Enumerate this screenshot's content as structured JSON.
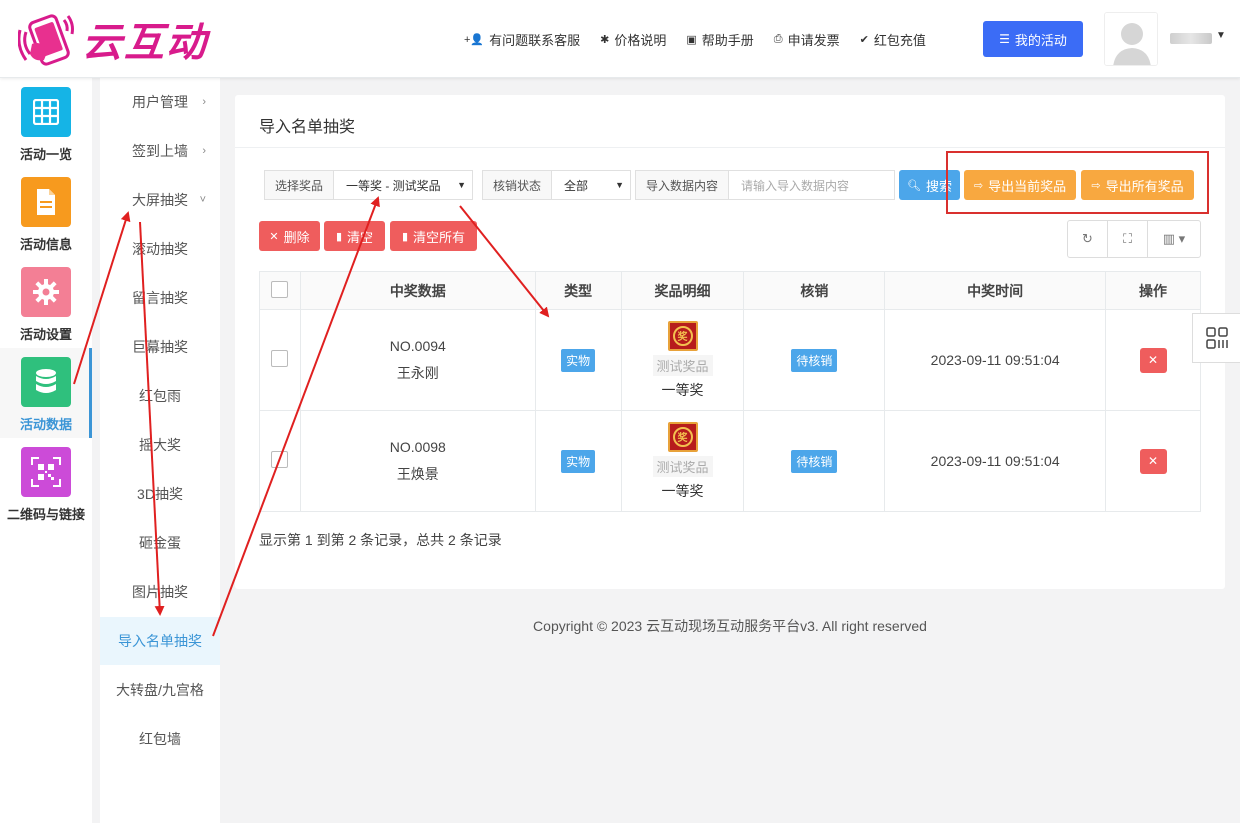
{
  "brand": {
    "name": "云互动"
  },
  "topnav": [
    {
      "icon": "add-user-icon",
      "label": "有问题联系客服"
    },
    {
      "icon": "gear-icon",
      "label": "价格说明"
    },
    {
      "icon": "book-icon",
      "label": "帮助手册"
    },
    {
      "icon": "printer-icon",
      "label": "申请发票"
    },
    {
      "icon": "shield-check-icon",
      "label": "红包充值"
    }
  ],
  "my_activity": {
    "label": "我的活动",
    "icon": "list-icon",
    "color": "#3b6cf6"
  },
  "iconbar": [
    {
      "label": "活动一览",
      "icon": "grid-icon",
      "color": "#15b4e6"
    },
    {
      "label": "活动信息",
      "icon": "document-icon",
      "color": "#f79a1e"
    },
    {
      "label": "活动设置",
      "icon": "gear-icon",
      "color": "#f37f95"
    },
    {
      "label": "活动数据",
      "icon": "database-icon",
      "color": "#2fc07d",
      "active": true
    },
    {
      "label": "二维码与链接",
      "icon": "qrcode-icon",
      "color": "#cc4bd8"
    }
  ],
  "submenu": [
    {
      "label": "用户管理",
      "arrow": "›"
    },
    {
      "label": "签到上墙",
      "arrow": "›"
    },
    {
      "label": "大屏抽奖",
      "arrow": "˅"
    },
    {
      "label": "滚动抽奖"
    },
    {
      "label": "留言抽奖"
    },
    {
      "label": "巨幕抽奖"
    },
    {
      "label": "红包雨"
    },
    {
      "label": "摇大奖"
    },
    {
      "label": "3D抽奖"
    },
    {
      "label": "砸金蛋"
    },
    {
      "label": "图片抽奖"
    },
    {
      "label": "导入名单抽奖",
      "active": true
    },
    {
      "label": "大转盘/九宫格"
    },
    {
      "label": "红包墙"
    }
  ],
  "panel": {
    "title": "导入名单抽奖"
  },
  "filters": {
    "prize_label": "选择奖品",
    "prize_value": "一等奖 - 测试奖品",
    "status_label": "核销状态",
    "status_value": "全部",
    "content_label": "导入数据内容",
    "content_placeholder": "请输入导入数据内容",
    "search_label": "搜索"
  },
  "actions": {
    "export_current": "导出当前奖品",
    "export_all": "导出所有奖品",
    "delete": "删除",
    "clear": "清空",
    "clear_all": "清空所有"
  },
  "table": {
    "headers": [
      "中奖数据",
      "类型",
      "奖品明细",
      "核销",
      "中奖时间",
      "操作"
    ],
    "rows": [
      {
        "no": "NO.0094",
        "name": "王永刚",
        "type": "实物",
        "prize_name": "测试奖品",
        "prize_level": "一等奖",
        "status": "待核销",
        "time": "2023-09-11 09:51:04"
      },
      {
        "no": "NO.0098",
        "name": "王焕景",
        "type": "实物",
        "prize_name": "测试奖品",
        "prize_level": "一等奖",
        "status": "待核销",
        "time": "2023-09-11 09:51:04"
      }
    ],
    "prize_icon_char": "奖"
  },
  "summary": "显示第 1 到第 2 条记录，总共 2 条记录",
  "footer": "Copyright © 2023 云互动现场互动服务平台v3. All right reserved"
}
